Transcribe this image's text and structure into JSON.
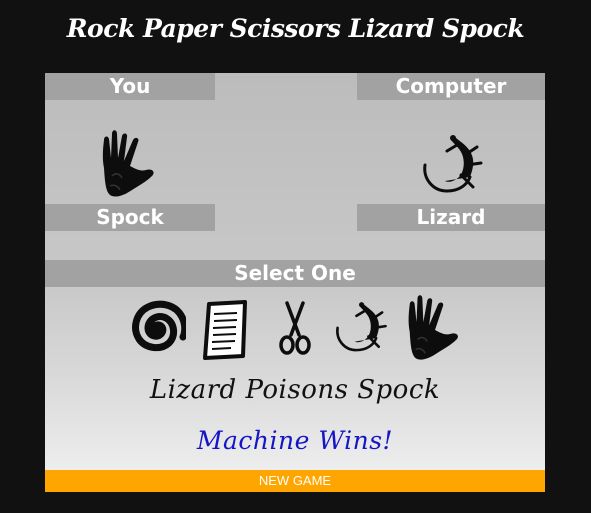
{
  "title": "Rock Paper Scissors Lizard Spock",
  "player": {
    "label": "You",
    "choice": "Spock",
    "icon": "spock-hand-icon"
  },
  "computer": {
    "label": "Computer",
    "choice": "Lizard",
    "icon": "lizard-icon"
  },
  "select_label": "Select One",
  "choices": [
    {
      "name": "Rock",
      "icon": "rock-spiral-icon"
    },
    {
      "name": "Paper",
      "icon": "paper-icon"
    },
    {
      "name": "Scissors",
      "icon": "scissors-icon"
    },
    {
      "name": "Lizard",
      "icon": "lizard-icon"
    },
    {
      "name": "Spock",
      "icon": "spock-hand-icon"
    }
  ],
  "result": "Lizard Poisons Spock",
  "winner": "Machine Wins!",
  "new_game_label": "NEW GAME",
  "colors": {
    "background": "#111111",
    "label_bar": "#a2a2a2",
    "button": "#ffa500",
    "winner_text": "#1515c8"
  }
}
